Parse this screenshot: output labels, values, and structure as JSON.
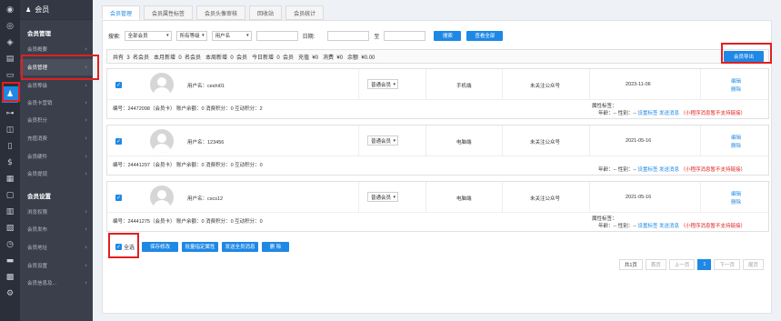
{
  "sidebar_icons": [
    "gauge-icon",
    "compass-icon",
    "cube-icon",
    "clipboard-icon",
    "doc-icon",
    "image-icon",
    "user-icon",
    "org-chart-icon",
    "bag-icon",
    "file-icon",
    "dollar-icon",
    "grid-icon",
    "box-icon",
    "book-icon",
    "chart-icon",
    "clock-icon",
    "card-icon",
    "id-card-icon",
    "grid-icon",
    "gear-icon"
  ],
  "menu": {
    "header": "会员",
    "group1": "会员管理",
    "group2": "会员设置",
    "items": [
      {
        "label": "会员概要"
      },
      {
        "label": "会员管理"
      },
      {
        "label": "会员等级"
      },
      {
        "label": "会员卡营销"
      },
      {
        "label": "会员积分"
      },
      {
        "label": "充值消费"
      },
      {
        "label": "会员硬件"
      },
      {
        "label": "会员提现"
      },
      {
        "label": "浏览权限"
      },
      {
        "label": "会员发布"
      },
      {
        "label": "会员地址"
      },
      {
        "label": "会员设置"
      },
      {
        "label": "会员信息及..."
      }
    ]
  },
  "tabs": [
    "会员管理",
    "会员属性标签",
    "会员头像审核",
    "回收站",
    "会员统计"
  ],
  "filter": {
    "search_label": "搜索:",
    "select1": "全部会员",
    "select2": "所有等级",
    "select3": "用户名",
    "date_label": "日期:",
    "to_label": "至",
    "search_btn": "搜索",
    "all_btn": "查看全部"
  },
  "stats_text": "共有  3  名会员   本月新增  0  名会员   本周新增  0  会员   今日新增  0  会员   充值  ¥0   消费  ¥0   余额  ¥0.00",
  "export_btn": "会员导出",
  "members": [
    {
      "username": "用户名：ceshi01",
      "level": "普通会员",
      "device": "手机端",
      "wechat": "未关注公众号",
      "date": "2023-11-06",
      "edit": "编辑",
      "del": "删除",
      "meta": "编号：24472098（会员卡）   账户余额：0   消费积分：0   互动积分：2",
      "attr_label": "属性标签：",
      "info": "年龄：--   性别：--",
      "set_tag": "设置标签",
      "send_msg": "发送消息",
      "note": "（小程序消息暂不支持链接）"
    },
    {
      "username": "用户名：123456",
      "level": "普通会员",
      "device": "电脑端",
      "wechat": "未关注公众号",
      "date": "2021-05-16",
      "edit": "编辑",
      "del": "删除",
      "meta": "编号：24441297（会员卡）   账户余额：0   消费积分：0   互动积分：0",
      "attr_label": "",
      "info": "年龄：--   性别：--",
      "set_tag": "设置标签",
      "send_msg": "发送消息",
      "note": "（小程序消息暂不支持链接）"
    },
    {
      "username": "用户名：cscs12",
      "level": "普通会员",
      "device": "电脑端",
      "wechat": "未关注公众号",
      "date": "2021-05-16",
      "edit": "编辑",
      "del": "删除",
      "meta": "编号：24441275（会员卡）   账户余额：0   消费积分：0   互动积分：0",
      "attr_label": "属性标签：",
      "info": "年龄：--   性别：--",
      "set_tag": "设置标签",
      "send_msg": "发送消息",
      "note": "（小程序消息暂不支持链接）"
    }
  ],
  "bulk": {
    "select_all": "全选",
    "save": "保存修改",
    "batch_tag": "批量指定属性",
    "send_all": "发送全员消息",
    "delete": "删 除"
  },
  "pager": [
    "共1页",
    "首页",
    "上一页",
    "1",
    "下一页",
    "尾页"
  ],
  "colors": {
    "accent": "#1e88e5",
    "highlight": "#e02020",
    "sidebar": "#2b2f3a"
  }
}
